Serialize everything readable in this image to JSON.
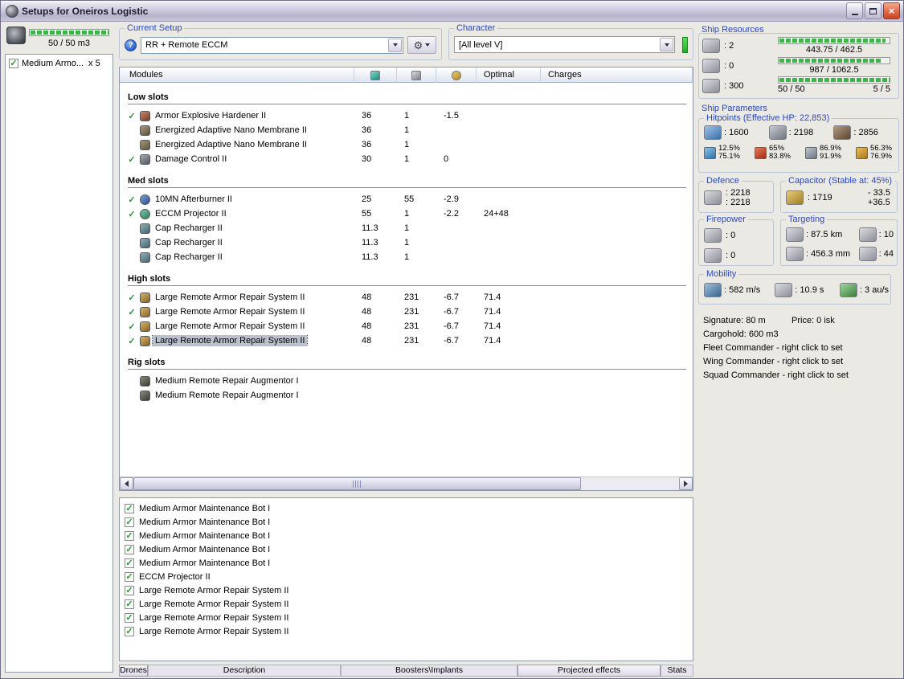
{
  "colors": {
    "accent": "#2948c8",
    "bar-green": "#3cb44a",
    "check-green": "#1e9c28",
    "titlebar-text": "#1c1c30"
  },
  "window": {
    "title": "Setups for Oneiros Logistic"
  },
  "left_panel": {
    "capacity": "50 / 50 m3",
    "capacity_pct": 100,
    "items": [
      {
        "checked": true,
        "label": "Medium Armo...",
        "count": "x 5"
      }
    ]
  },
  "current_setup": {
    "label": "Current Setup",
    "value": "RR + Remote ECCM"
  },
  "character": {
    "label": "Character",
    "value": "[All level V]"
  },
  "modules": {
    "columns": {
      "name": "Modules",
      "optimal": "Optimal",
      "charges": "Charges"
    },
    "sections": [
      {
        "name": "Low slots",
        "rows": [
          {
            "checked": true,
            "icon": "armor-hardener",
            "name": "Armor Explosive Hardener II",
            "cpu": "36",
            "pg": "1",
            "cap": "-1.5",
            "optimal": "",
            "charges": ""
          },
          {
            "checked": false,
            "icon": "nano-membrane",
            "name": "Energized Adaptive Nano Membrane II",
            "cpu": "36",
            "pg": "1",
            "cap": "",
            "optimal": "",
            "charges": ""
          },
          {
            "checked": false,
            "icon": "nano-membrane",
            "name": "Energized Adaptive Nano Membrane II",
            "cpu": "36",
            "pg": "1",
            "cap": "",
            "optimal": "",
            "charges": ""
          },
          {
            "checked": true,
            "icon": "damage-control",
            "name": "Damage Control II",
            "cpu": "30",
            "pg": "1",
            "cap": "0",
            "optimal": "",
            "charges": ""
          }
        ]
      },
      {
        "name": "Med slots",
        "rows": [
          {
            "checked": true,
            "icon": "afterburner",
            "name": "10MN Afterburner II",
            "cpu": "25",
            "pg": "55",
            "cap": "-2.9",
            "optimal": "",
            "charges": ""
          },
          {
            "checked": true,
            "icon": "eccm",
            "name": "ECCM Projector II",
            "cpu": "55",
            "pg": "1",
            "cap": "-2.2",
            "optimal": "24+48",
            "charges": ""
          },
          {
            "checked": false,
            "icon": "cap-recharger",
            "name": "Cap Recharger II",
            "cpu": "11.3",
            "pg": "1",
            "cap": "",
            "optimal": "",
            "charges": ""
          },
          {
            "checked": false,
            "icon": "cap-recharger",
            "name": "Cap Recharger II",
            "cpu": "11.3",
            "pg": "1",
            "cap": "",
            "optimal": "",
            "charges": ""
          },
          {
            "checked": false,
            "icon": "cap-recharger",
            "name": "Cap Recharger II",
            "cpu": "11.3",
            "pg": "1",
            "cap": "",
            "optimal": "",
            "charges": ""
          }
        ]
      },
      {
        "name": "High slots",
        "rows": [
          {
            "checked": true,
            "icon": "remote-repair",
            "name": "Large Remote Armor Repair System II",
            "cpu": "48",
            "pg": "231",
            "cap": "-6.7",
            "optimal": "71.4",
            "charges": ""
          },
          {
            "checked": true,
            "icon": "remote-repair",
            "name": "Large Remote Armor Repair System II",
            "cpu": "48",
            "pg": "231",
            "cap": "-6.7",
            "optimal": "71.4",
            "charges": ""
          },
          {
            "checked": true,
            "icon": "remote-repair",
            "name": "Large Remote Armor Repair System II",
            "cpu": "48",
            "pg": "231",
            "cap": "-6.7",
            "optimal": "71.4",
            "charges": ""
          },
          {
            "checked": true,
            "icon": "remote-repair",
            "name": "Large Remote Armor Repair System II",
            "cpu": "48",
            "pg": "231",
            "cap": "-6.7",
            "optimal": "71.4",
            "charges": "",
            "selected": true
          }
        ]
      },
      {
        "name": "Rig slots",
        "rows": [
          {
            "checked": false,
            "icon": "rig-augmentor",
            "name": "Medium Remote Repair Augmentor I",
            "cpu": "",
            "pg": "",
            "cap": "",
            "optimal": "",
            "charges": ""
          },
          {
            "checked": false,
            "icon": "rig-augmentor",
            "name": "Medium Remote Repair Augmentor I",
            "cpu": "",
            "pg": "",
            "cap": "",
            "optimal": "",
            "charges": ""
          }
        ]
      }
    ]
  },
  "drones": {
    "items": [
      {
        "checked": true,
        "name": "Medium Armor Maintenance Bot I"
      },
      {
        "checked": true,
        "name": "Medium Armor Maintenance Bot I"
      },
      {
        "checked": true,
        "name": "Medium Armor Maintenance Bot I"
      },
      {
        "checked": true,
        "name": "Medium Armor Maintenance Bot I"
      },
      {
        "checked": true,
        "name": "Medium Armor Maintenance Bot I"
      },
      {
        "checked": true,
        "name": "ECCM Projector II"
      },
      {
        "checked": true,
        "name": "Large Remote Armor Repair System II"
      },
      {
        "checked": true,
        "name": "Large Remote Armor Repair System II"
      },
      {
        "checked": true,
        "name": "Large Remote Armor Repair System II"
      },
      {
        "checked": true,
        "name": "Large Remote Armor Repair System II"
      }
    ]
  },
  "bottom_tabs": [
    {
      "label": "Drones",
      "raised": true
    },
    {
      "label": "Description",
      "raised": false
    },
    {
      "label": "Boosters\\Implants",
      "raised": false
    },
    {
      "label": "Projected effects",
      "raised": true
    },
    {
      "label": "Stats",
      "raised": false
    }
  ],
  "ship_resources": {
    "label": "Ship Resources",
    "turrets": ": 2",
    "launchers": ": 0",
    "calibration": ": 300",
    "bars": [
      {
        "name": "cpu",
        "text": "443.75 / 462.5",
        "pct": 96
      },
      {
        "name": "powergrid",
        "text": "987 / 1062.5",
        "pct": 93
      },
      {
        "name": "cargo",
        "text": "50 / 50",
        "text_right": "5 / 5",
        "pct": 100
      }
    ]
  },
  "ship_parameters": {
    "label": "Ship Parameters",
    "hitpoints": {
      "label": "Hitpoints (Effective HP: 22,853)",
      "shield": ": 1600",
      "armor": ": 2198",
      "hull": ": 2856",
      "resists": [
        {
          "type": "em",
          "top": "12.5%",
          "bottom": "75.1%"
        },
        {
          "type": "thermal",
          "top": "65%",
          "bottom": "83.8%"
        },
        {
          "type": "kinetic",
          "top": "86.9%",
          "bottom": "91.9%"
        },
        {
          "type": "explosive",
          "top": "56.3%",
          "bottom": "76.9%"
        }
      ]
    },
    "defence": {
      "label": "Defence",
      "value1": ": 2218",
      "value2": ": 2218"
    },
    "capacitor": {
      "label": "Capacitor (Stable at: 45%)",
      "amount": ": 1719",
      "usage": "- 33.5",
      "recharge": "+36.5"
    },
    "firepower": {
      "label": "Firepower",
      "turret": ": 0",
      "missile": ": 0"
    },
    "targeting": {
      "label": "Targeting",
      "range": ": 87.5 km",
      "max_targets": ": 10",
      "scan_resolution": ": 456.3 mm",
      "sensor_strength": ": 44"
    },
    "mobility": {
      "label": "Mobility",
      "speed": ": 582 m/s",
      "align_time": ": 10.9 s",
      "warp_speed": ": 3 au/s"
    },
    "info": {
      "signature": "Signature: 80 m",
      "price": "Price: 0 isk",
      "lines": [
        "Cargohold: 600 m3",
        "Fleet Commander - right click to set",
        "Wing Commander - right click to set",
        "Squad Commander - right click to set"
      ]
    }
  }
}
